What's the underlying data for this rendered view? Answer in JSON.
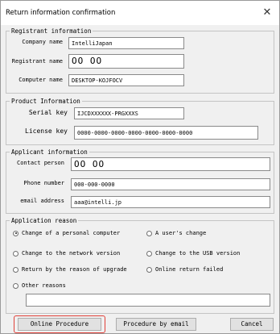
{
  "window": {
    "title": "Return information confirmation",
    "close_glyph": "✕"
  },
  "registrant": {
    "legend": "Registrant information",
    "company_label": "Company name",
    "company_value": "IntelliJapan",
    "registrant_label": "Registrant name",
    "registrant_value": "OO OO",
    "computer_label": "Computer name",
    "computer_value": "DESKTOP-KOJFOCV"
  },
  "product": {
    "legend": "Product Information",
    "serial_label": "Serial key",
    "serial_value": "IJCDXXXXXX-PRGXXXS",
    "license_label": "License key",
    "license_value": "0000-0000-0000-0000-0000-0000-0000"
  },
  "applicant": {
    "legend": "Applicant information",
    "contact_label": "Contact person",
    "contact_value": "OO OO",
    "phone_label": "Phone number",
    "phone_value": "000-000-0000",
    "email_label": "email address",
    "email_value": "aaa@intelli.jp"
  },
  "reason": {
    "legend": "Application reason",
    "options": [
      {
        "label": "Change of a personal computer",
        "selected": true
      },
      {
        "label": "A user's change",
        "selected": false
      },
      {
        "label": "Change to the network version",
        "selected": false
      },
      {
        "label": "Change to the USB version",
        "selected": false
      },
      {
        "label": "Return by the reason of upgrade",
        "selected": false
      },
      {
        "label": "Online return failed",
        "selected": false
      },
      {
        "label": "Other reasons",
        "selected": false
      }
    ],
    "other_text": ""
  },
  "buttons": {
    "online": "Online Procedure",
    "email": "Procedure by email",
    "cancel": "Cancel"
  },
  "colors": {
    "highlight": "#e0413a"
  }
}
